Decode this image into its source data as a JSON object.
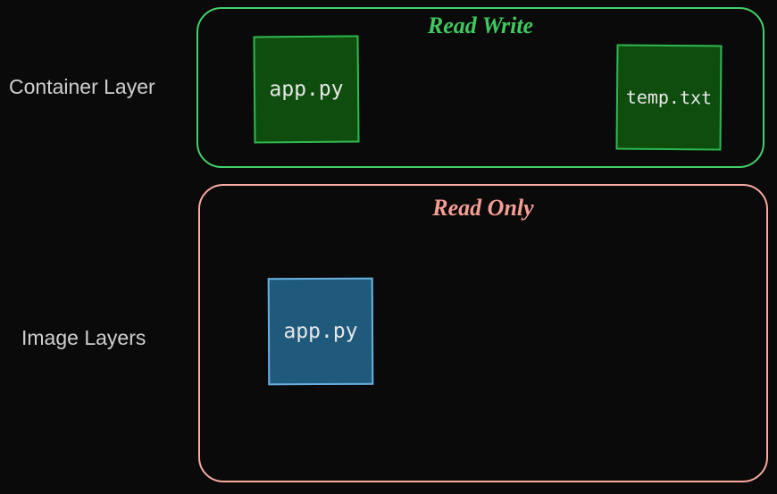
{
  "labels": {
    "container_layer": "Container Layer",
    "image_layers": "Image Layers"
  },
  "container_panel": {
    "title": "Read Write",
    "files": {
      "app": "app.py",
      "temp": "temp.txt"
    }
  },
  "image_panel": {
    "title": "Read Only",
    "files": {
      "app": "app.py"
    }
  },
  "colors": {
    "panel_green": "#45d06a",
    "panel_title_green": "#3fc95f",
    "panel_salmon": "#f8a9a0",
    "panel_title_salmon": "#f59e94"
  }
}
